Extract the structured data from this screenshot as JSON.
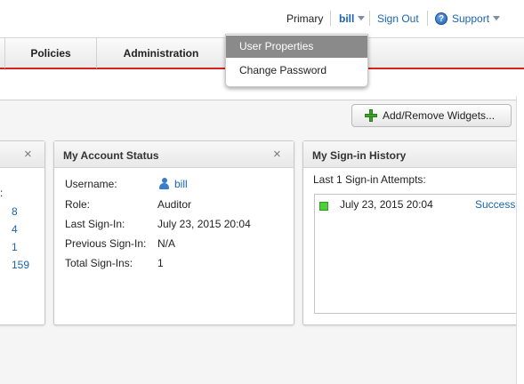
{
  "topbar": {
    "primary_label": "Primary",
    "user_label": "bill",
    "signout_label": "Sign Out",
    "support_label": "Support"
  },
  "nav": {
    "items": [
      {
        "label": "Policies"
      },
      {
        "label": "Administration"
      }
    ]
  },
  "user_menu": {
    "items": [
      {
        "label": "User Properties",
        "active": true
      },
      {
        "label": "Change Password",
        "active": false
      }
    ]
  },
  "toolbar": {
    "add_remove_label": "Add/Remove Widgets..."
  },
  "widgets": {
    "partial": {
      "colon": ":",
      "values": [
        "8",
        "4",
        "1",
        "159"
      ]
    },
    "account_status": {
      "title": "My Account Status",
      "rows": [
        {
          "label": "Username:",
          "value": "bill"
        },
        {
          "label": "Role:",
          "value": "Auditor"
        },
        {
          "label": "Last Sign-In:",
          "value": "July 23, 2015 20:04"
        },
        {
          "label": "Previous Sign-In:",
          "value": "N/A"
        },
        {
          "label": "Total Sign-Ins:",
          "value": "1"
        }
      ]
    },
    "signin_history": {
      "title": "My Sign-in History",
      "subtitle": "Last 1 Sign-in Attempts:",
      "entries": [
        {
          "date": "July 23, 2015 20:04",
          "status": "Success"
        }
      ]
    }
  },
  "colors": {
    "link": "#1a64b0",
    "nav_accent": "#d9221c",
    "menu_active_bg": "#8a8a8a",
    "success_indicator": "#4bd13a"
  },
  "icons": {
    "close": "×",
    "help": "?"
  }
}
